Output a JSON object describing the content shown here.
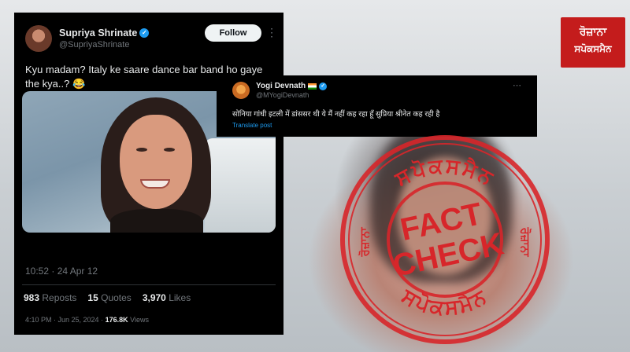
{
  "tweet": {
    "name": "Supriya Shrinate",
    "handle": "@SupriyaShrinate",
    "follow_label": "Follow",
    "more": "⋮",
    "text": "Kyu madam? Italy ke saare dance bar band ho gaye the kya..? 😂",
    "time": "10:52 · 24 Apr 12",
    "reposts_count": "983",
    "reposts_label": "Reposts",
    "quotes_count": "15",
    "quotes_label": "Quotes",
    "likes_count": "3,970",
    "likes_label": "Likes",
    "posted": "4:10 PM · Jun 25, 2024 ·",
    "views_count": "176.8K",
    "views_label": "Views"
  },
  "tweet2": {
    "name": "Yogi Devnath",
    "handle": "@MYogiDevnath",
    "more": "⋯",
    "text": "सोनिया गांधी इटली में डांससर थी ये मैं नहीं कह रहा हूँ सुप्रिया श्रीनेत कह रही है",
    "translate": "Translate post"
  },
  "logo": {
    "line1": "ਰੋਜ਼ਾਨਾ",
    "line2": "ਸਪੋਕਸਮੈਨ"
  },
  "stamp": {
    "top_arc": "ਸਪੋਕਸਮੈਨ",
    "bottom_arc": "ਸਪੋਕਸਮੈਨ",
    "left_word": "ਰੋਜ਼ਾਨਾ",
    "right_word": "ਰੋਜ਼ਾਨਾ",
    "word1": "FACT",
    "word2": "CHECK",
    "color": "#d7262a"
  }
}
